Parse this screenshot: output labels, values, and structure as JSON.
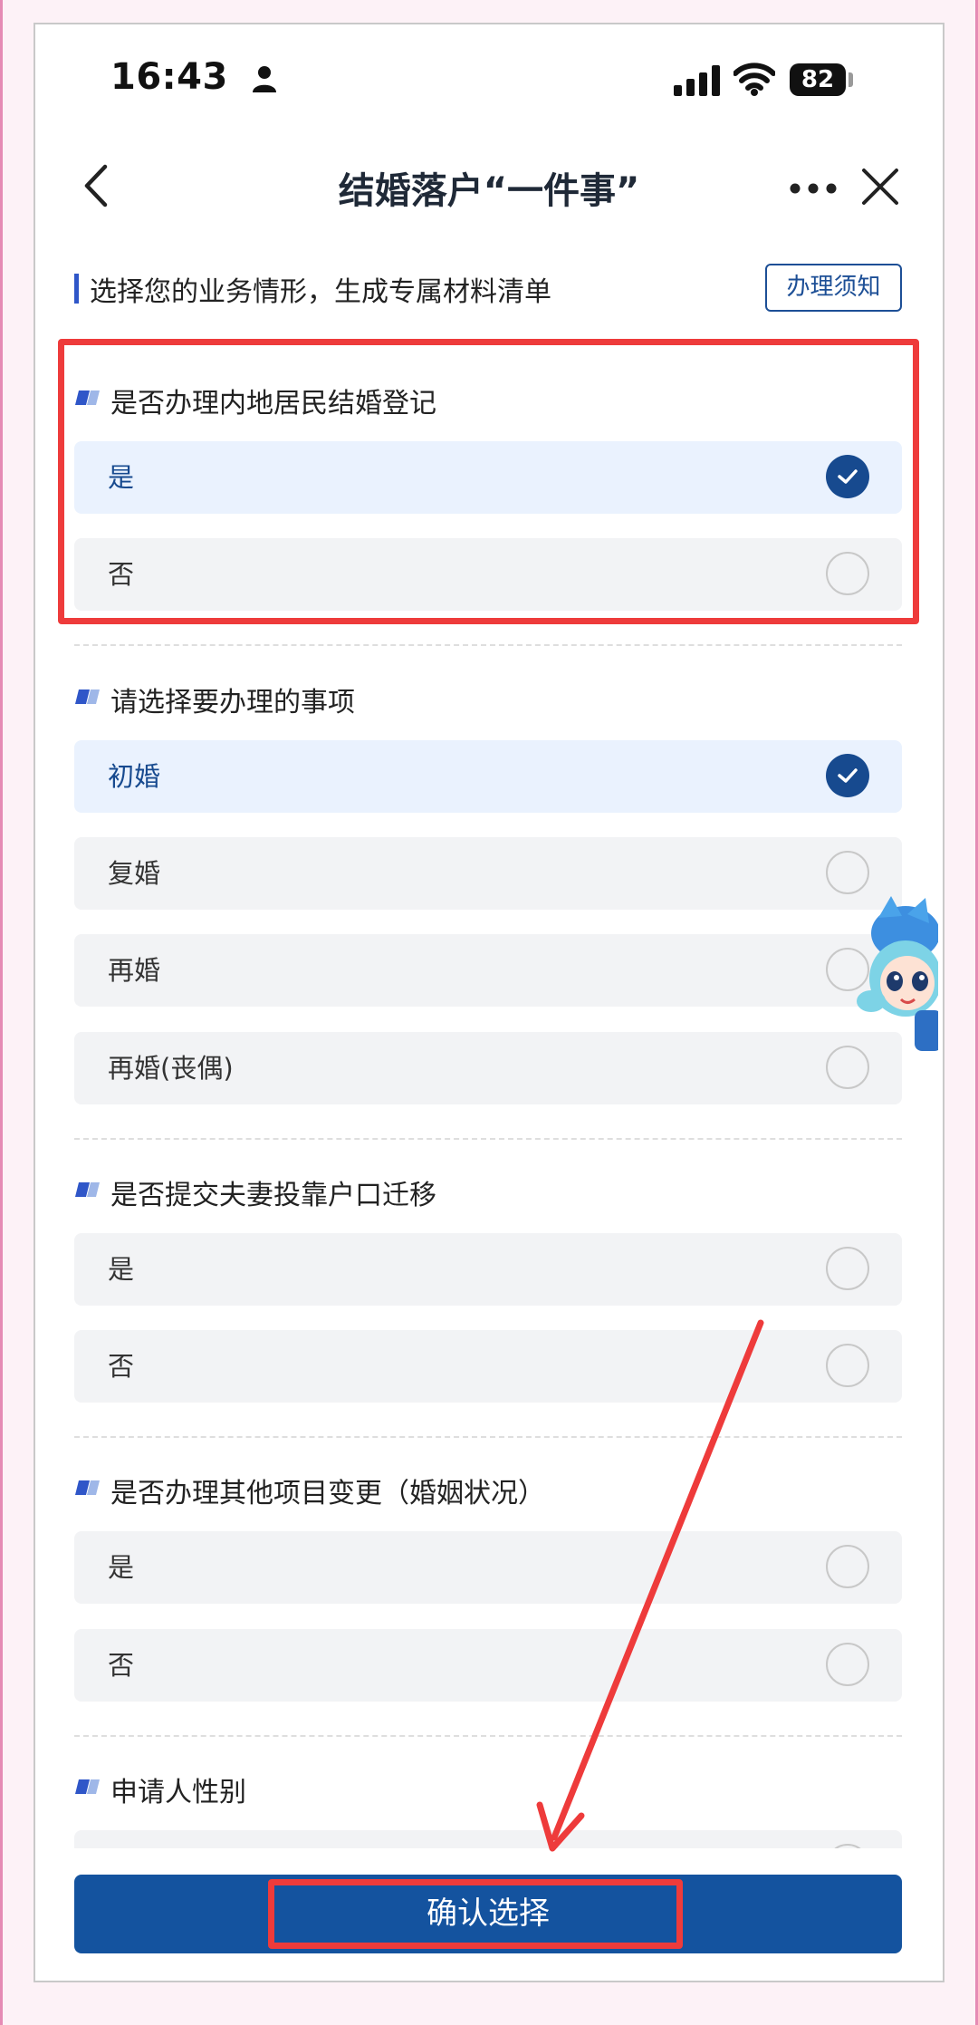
{
  "status_bar": {
    "time": "16:43",
    "battery": "82"
  },
  "header": {
    "title": "结婚落户“一件事”"
  },
  "subheader": {
    "text": "选择您的业务情形，生成专属材料清单",
    "notice_button": "办理须知"
  },
  "sections": [
    {
      "title": "是否办理内地居民结婚登记",
      "options": [
        {
          "label": "是",
          "checked": true
        },
        {
          "label": "否",
          "checked": false
        }
      ]
    },
    {
      "title": "请选择要办理的事项",
      "options": [
        {
          "label": "初婚",
          "checked": true
        },
        {
          "label": "复婚",
          "checked": false
        },
        {
          "label": "再婚",
          "checked": false
        },
        {
          "label": "再婚(丧偶)",
          "checked": false
        }
      ]
    },
    {
      "title": "是否提交夫妻投靠户口迁移",
      "options": [
        {
          "label": "是",
          "checked": false
        },
        {
          "label": "否",
          "checked": false
        }
      ]
    },
    {
      "title": "是否办理其他项目变更（婚姻状况）",
      "options": [
        {
          "label": "是",
          "checked": false
        },
        {
          "label": "否",
          "checked": false
        }
      ]
    },
    {
      "title": "申请人性别",
      "options": []
    }
  ],
  "confirm_button": "确认选择",
  "colors": {
    "primary": "#14539f",
    "selected_bg": "#eaf2fe",
    "option_bg": "#f2f3f5",
    "annotation_red": "#ee3b3b",
    "accent_bar": "#2f56c8"
  },
  "icons": [
    "person-icon",
    "cellular-signal-icon",
    "wifi-icon",
    "battery-icon",
    "back-chevron-icon",
    "more-dots-icon",
    "close-icon",
    "section-flag-icon",
    "check-icon",
    "assistant-mascot-icon"
  ]
}
